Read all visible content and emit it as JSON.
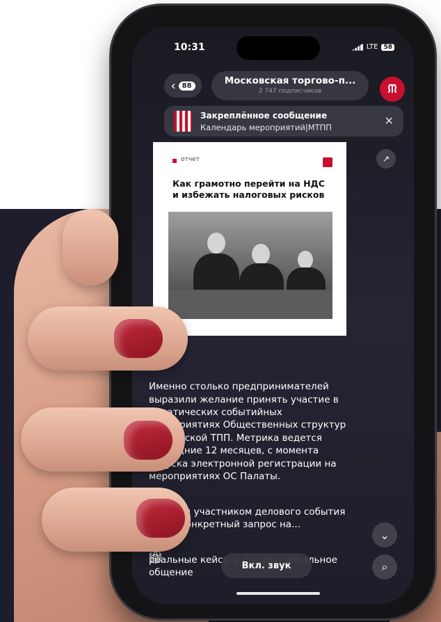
{
  "status": {
    "time": "10:31",
    "network": "LTE",
    "battery": "58"
  },
  "header": {
    "back_count": "88",
    "title": "Московская торгово-п...",
    "subtitle": "2 747 подписчиков"
  },
  "pinned": {
    "label": "Закреплённое сообщение",
    "text": "Календарь мероприятий|МТПП"
  },
  "card": {
    "tag": "отчет",
    "headline": "Как грамотно перейти на НДС и избежать налоговых рисков"
  },
  "message": {
    "p1": "Именно столько предпринимателей выразили желание принять участие в тематических событийных мероприятиях Общественных структур Московской ТПП. Метрика ведется последние 12 месяцев, с момента запуска электронной регистрации на мероприятиях ОС Палаты.",
    "p2": "Каждым участником делового события стоит конкретный запрос на...",
    "p3": "реальные кейсы и профессиональное общение"
  },
  "controls": {
    "sound_label": "Вкл. звук"
  },
  "icons": {
    "back": "chevron-left-icon",
    "close": "close-icon",
    "scroll_down": "chevron-down-icon",
    "search": "search-icon",
    "gift": "gift-icon",
    "share": "share-icon"
  },
  "colors": {
    "accent": "#c8102e",
    "nail": "#a51c2c",
    "backdrop": "#1d1d2b"
  }
}
